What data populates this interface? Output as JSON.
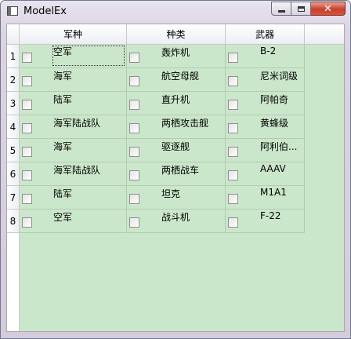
{
  "window": {
    "title": "ModelEx"
  },
  "table": {
    "columns": [
      "军种",
      "种类",
      "武器"
    ],
    "rows": [
      {
        "header": "1",
        "cells": [
          "空军",
          "轰炸机",
          "B-2"
        ]
      },
      {
        "header": "2",
        "cells": [
          "海军",
          "航空母舰",
          "尼米词级"
        ]
      },
      {
        "header": "3",
        "cells": [
          "陆军",
          "直升机",
          "阿帕奇"
        ]
      },
      {
        "header": "4",
        "cells": [
          "海军陆战队",
          "两栖攻击舰",
          "黄蜂级"
        ]
      },
      {
        "header": "5",
        "cells": [
          "海军",
          "驱逐舰",
          "阿利伯..."
        ]
      },
      {
        "header": "6",
        "cells": [
          "海军陆战队",
          "两栖战车",
          "AAAV"
        ]
      },
      {
        "header": "7",
        "cells": [
          "陆军",
          "坦克",
          "M1A1"
        ]
      },
      {
        "header": "8",
        "cells": [
          "空军",
          "战斗机",
          "F-22"
        ]
      }
    ]
  }
}
